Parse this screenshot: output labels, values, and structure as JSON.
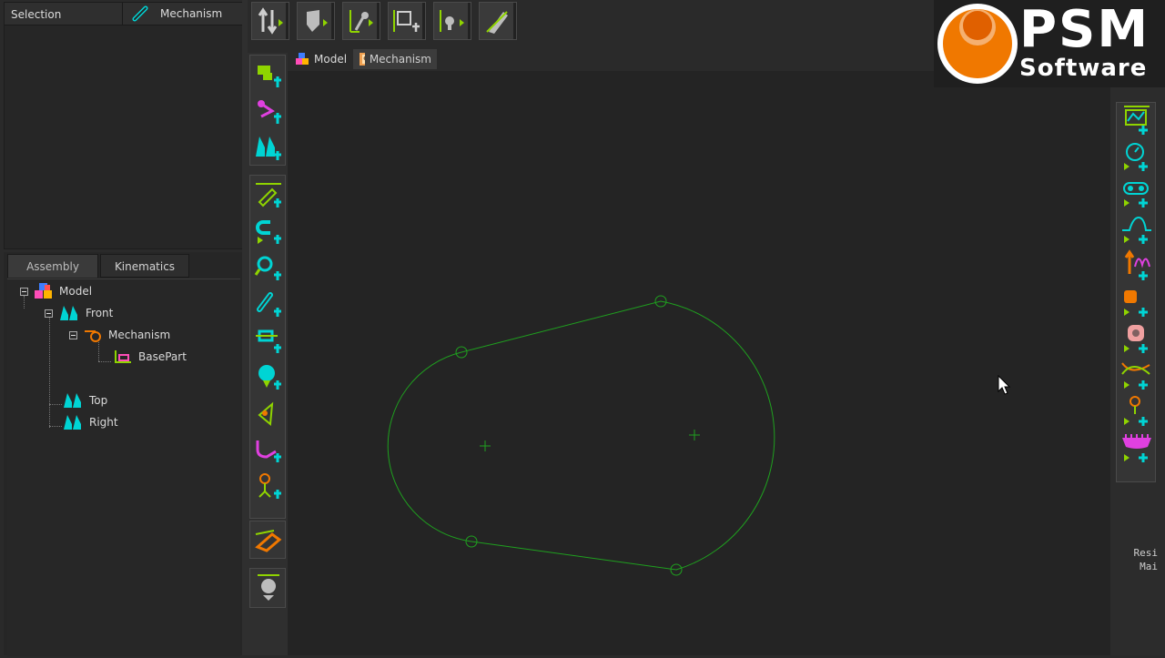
{
  "selection_panel": {
    "column_label": "Selection",
    "current_item": "Mechanism"
  },
  "tree_panel": {
    "tabs": [
      "Assembly",
      "Kinematics"
    ],
    "active_tab": "Assembly",
    "items": [
      {
        "label": "Model",
        "icon": "model-icon"
      },
      {
        "label": "Front",
        "icon": "plane-icon"
      },
      {
        "label": "Mechanism",
        "icon": "mechanism-icon"
      },
      {
        "label": "BasePart",
        "icon": "basepart-icon"
      },
      {
        "label": "Top",
        "icon": "plane-icon"
      },
      {
        "label": "Right",
        "icon": "plane-icon"
      }
    ]
  },
  "doc_tabs": [
    {
      "label": "Model",
      "icon": "model-icon"
    },
    {
      "label": "Mechanism",
      "icon": "mechanism-icon",
      "active": true
    }
  ],
  "logo": {
    "line1": "PSM",
    "line2": "Software"
  },
  "right_panel_text": {
    "line1": "Resi",
    "line2": "Mai"
  },
  "top_toolbar_icons": [
    "kinematics-add-icon",
    "shield-icon",
    "joint-icon",
    "frame-add-icon",
    "bulb-icon",
    "pen-icon"
  ],
  "left_toolbar_icons": [
    "add-part-icon",
    "add-mechanism-icon",
    "add-plane-icon",
    "add-sketch-icon",
    "add-magnet-icon",
    "add-search-icon",
    "add-link-icon",
    "add-slider-icon",
    "add-cam-icon",
    "add-point-icon",
    "add-curve-icon",
    "add-pin-icon",
    "eraser-icon",
    "ground-icon"
  ],
  "right_toolbar_icons": [
    "add-graph-icon",
    "add-motor-icon",
    "add-pulley-icon",
    "add-profile-icon",
    "add-force-icon",
    "add-block-icon",
    "add-2d-icon",
    "add-intersect-icon",
    "add-tracer-icon",
    "add-gear-icon"
  ],
  "colors": {
    "accent_green": "#8fd400",
    "cyan": "#00d4d4",
    "sketch_green": "#1fa01f",
    "logo_orange": "#f07800"
  }
}
